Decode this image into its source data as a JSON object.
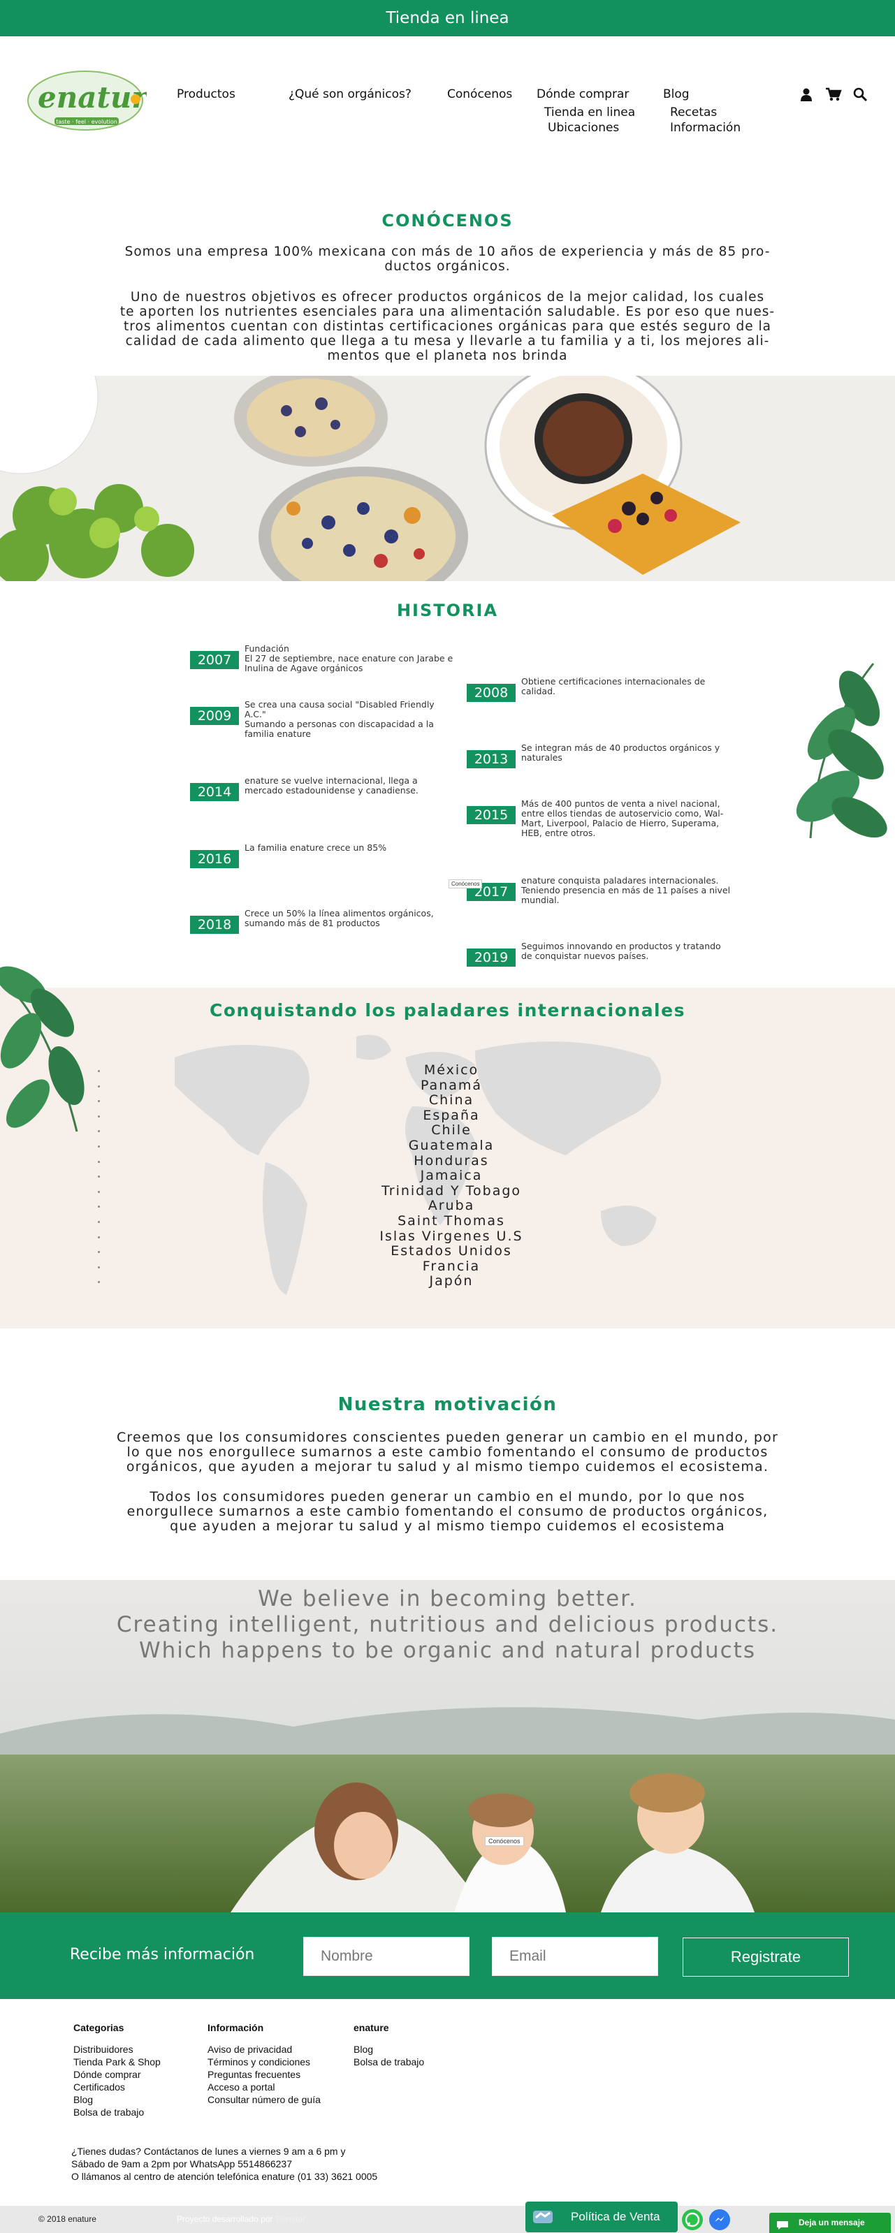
{
  "topbar": {
    "label": "Tienda en linea"
  },
  "header": {
    "logo_text": "enature",
    "logo_tagline": "taste · feel · evolution",
    "nav": {
      "productos": "Productos",
      "que_son": "¿Qué son orgánicos?",
      "conocenos": "Conócenos",
      "donde": "Dónde comprar",
      "donde_sub1": "Tienda en linea",
      "donde_sub2": "Ubicaciones",
      "blog": "Blog",
      "blog_sub1": "Recetas",
      "blog_sub2": "Información"
    },
    "icons": [
      "user-icon",
      "cart-icon",
      "search-icon"
    ]
  },
  "about": {
    "title": "CONÓCENOS",
    "p1_l1": "Somos una empresa 100% mexicana con más de 10 años de experiencia y más de 85 pro-",
    "p1_l2": "ductos orgánicos.",
    "p2_l1": "Uno de nuestros objetivos es ofrecer productos orgánicos de la mejor calidad, los cuales",
    "p2_l2": "te aporten los nutrientes esenciales para una alimentación saludable. Es por eso que nues-",
    "p2_l3": "tros alimentos cuentan con distintas certificaciones orgánicas para que estés seguro de la",
    "p2_l4": "calidad de cada alimento que llega a tu mesa y llevarle a tu familia y a ti, los mejores ali-",
    "p2_l5": "mentos que el planeta nos brinda"
  },
  "history": {
    "title": "HISTORIA",
    "events": [
      {
        "year": "2007",
        "text": "Fundación\nEl 27 de septiembre, nace enature con Jarabe e Inulina de Agave orgánicos"
      },
      {
        "year": "2008",
        "text": "Obtiene certificaciones internacionales de calidad."
      },
      {
        "year": "2009",
        "text": "Se crea una causa social \"Disabled Friendly A.C.\"\nSumando a personas con discapacidad a la familia enature"
      },
      {
        "year": "2013",
        "text": "Se integran más de 40 productos orgánicos y naturales"
      },
      {
        "year": "2014",
        "text": "enature se vuelve internacional, llega a mercado estadounidense y canadiense."
      },
      {
        "year": "2015",
        "text": "Más de 400 puntos de venta a nivel nacional, entre ellos tiendas de autoservicio como, Wal-Mart, Liverpool, Palacio de Hierro, Superama, HEB, entre otros."
      },
      {
        "year": "2016",
        "text": "La familia enature crece un 85%"
      },
      {
        "year": "2017",
        "text": "enature conquista paladares internacionales. Teniendo presencia en más de 11 países a nivel mundial."
      },
      {
        "year": "2018",
        "text": "Crece un 50% la línea alimentos orgánicos, sumando más de 81 productos"
      },
      {
        "year": "2019",
        "text": "Seguimos innovando en productos y tratando de conquistar nuevos países."
      }
    ],
    "tooltip": "Conócenos"
  },
  "international": {
    "title": "Conquistando los paladares internacionales",
    "countries": [
      "México",
      "Panamá",
      "China",
      "España",
      "Chile",
      "Guatemala",
      "Honduras",
      "Jamaica",
      "Trinidad Y Tobago",
      "Aruba",
      "Saint Thomas",
      "Islas Virgenes U.S",
      "Estados Unidos",
      "Francia",
      "Japón"
    ]
  },
  "motivation": {
    "title": "Nuestra motivación",
    "p1_l1": "Creemos que los consumidores conscientes pueden generar un cambio en el mundo, por",
    "p1_l2": "lo que nos enorgullece sumarnos a este cambio fomentando el consumo de productos",
    "p1_l3": "orgánicos, que ayuden a mejorar tu salud y  al mismo tiempo cuidemos  el ecosistema.",
    "p2_l1": "Todos los consumidores pueden generar un cambio en el mundo, por lo que nos",
    "p2_l2": "enorgullece sumarnos a este cambio fomentando el consumo de productos orgánicos,",
    "p2_l3": "que ayuden a mejorar tu salud y  al mismo tiempo cuidemos  el ecosistema"
  },
  "hero": {
    "line1": "We believe in becoming better.",
    "line2": "Creating intelligent, nutritious and delicious products.",
    "line3": "Which happens to be organic and natural products",
    "tooltip": "Conócenos"
  },
  "newsletter": {
    "label": "Recibe más información",
    "name_placeholder": "Nombre",
    "email_placeholder": "Email",
    "submit": "Registrate"
  },
  "footer": {
    "col1": {
      "title": "Categorias",
      "links": [
        "Distribuidores",
        "Tienda Park & Shop",
        "Dónde comprar",
        "Certificados",
        "Blog",
        "Bolsa de trabajo"
      ]
    },
    "col2": {
      "title": "Información",
      "links": [
        "Aviso de privacidad",
        "Términos y condiciones",
        "Preguntas frecuentes",
        "Acceso a portal",
        "Consultar número de guía"
      ]
    },
    "col3": {
      "title": "enature",
      "links": [
        "Blog",
        "Bolsa de trabajo"
      ]
    },
    "contact_l1": "¿Tienes dudas? Contáctanos de lunes a viernes 9 am a 6 pm y",
    "contact_l2": "Sábado de 9am a 2pm por WhatsApp  5514866237",
    "contact_l3": "O llámanos al centro de atención telefónica enature (01 33) 3621 0005",
    "copyright": "© 2018 enature",
    "credit_prefix": "Proyecto desarrollado por",
    "credit_name": "Tienetar",
    "policy": "Política de Venta",
    "chat": "Deja un mensaje"
  },
  "colors": {
    "brand_green": "#13925f",
    "intl_bg": "#f7efea"
  }
}
